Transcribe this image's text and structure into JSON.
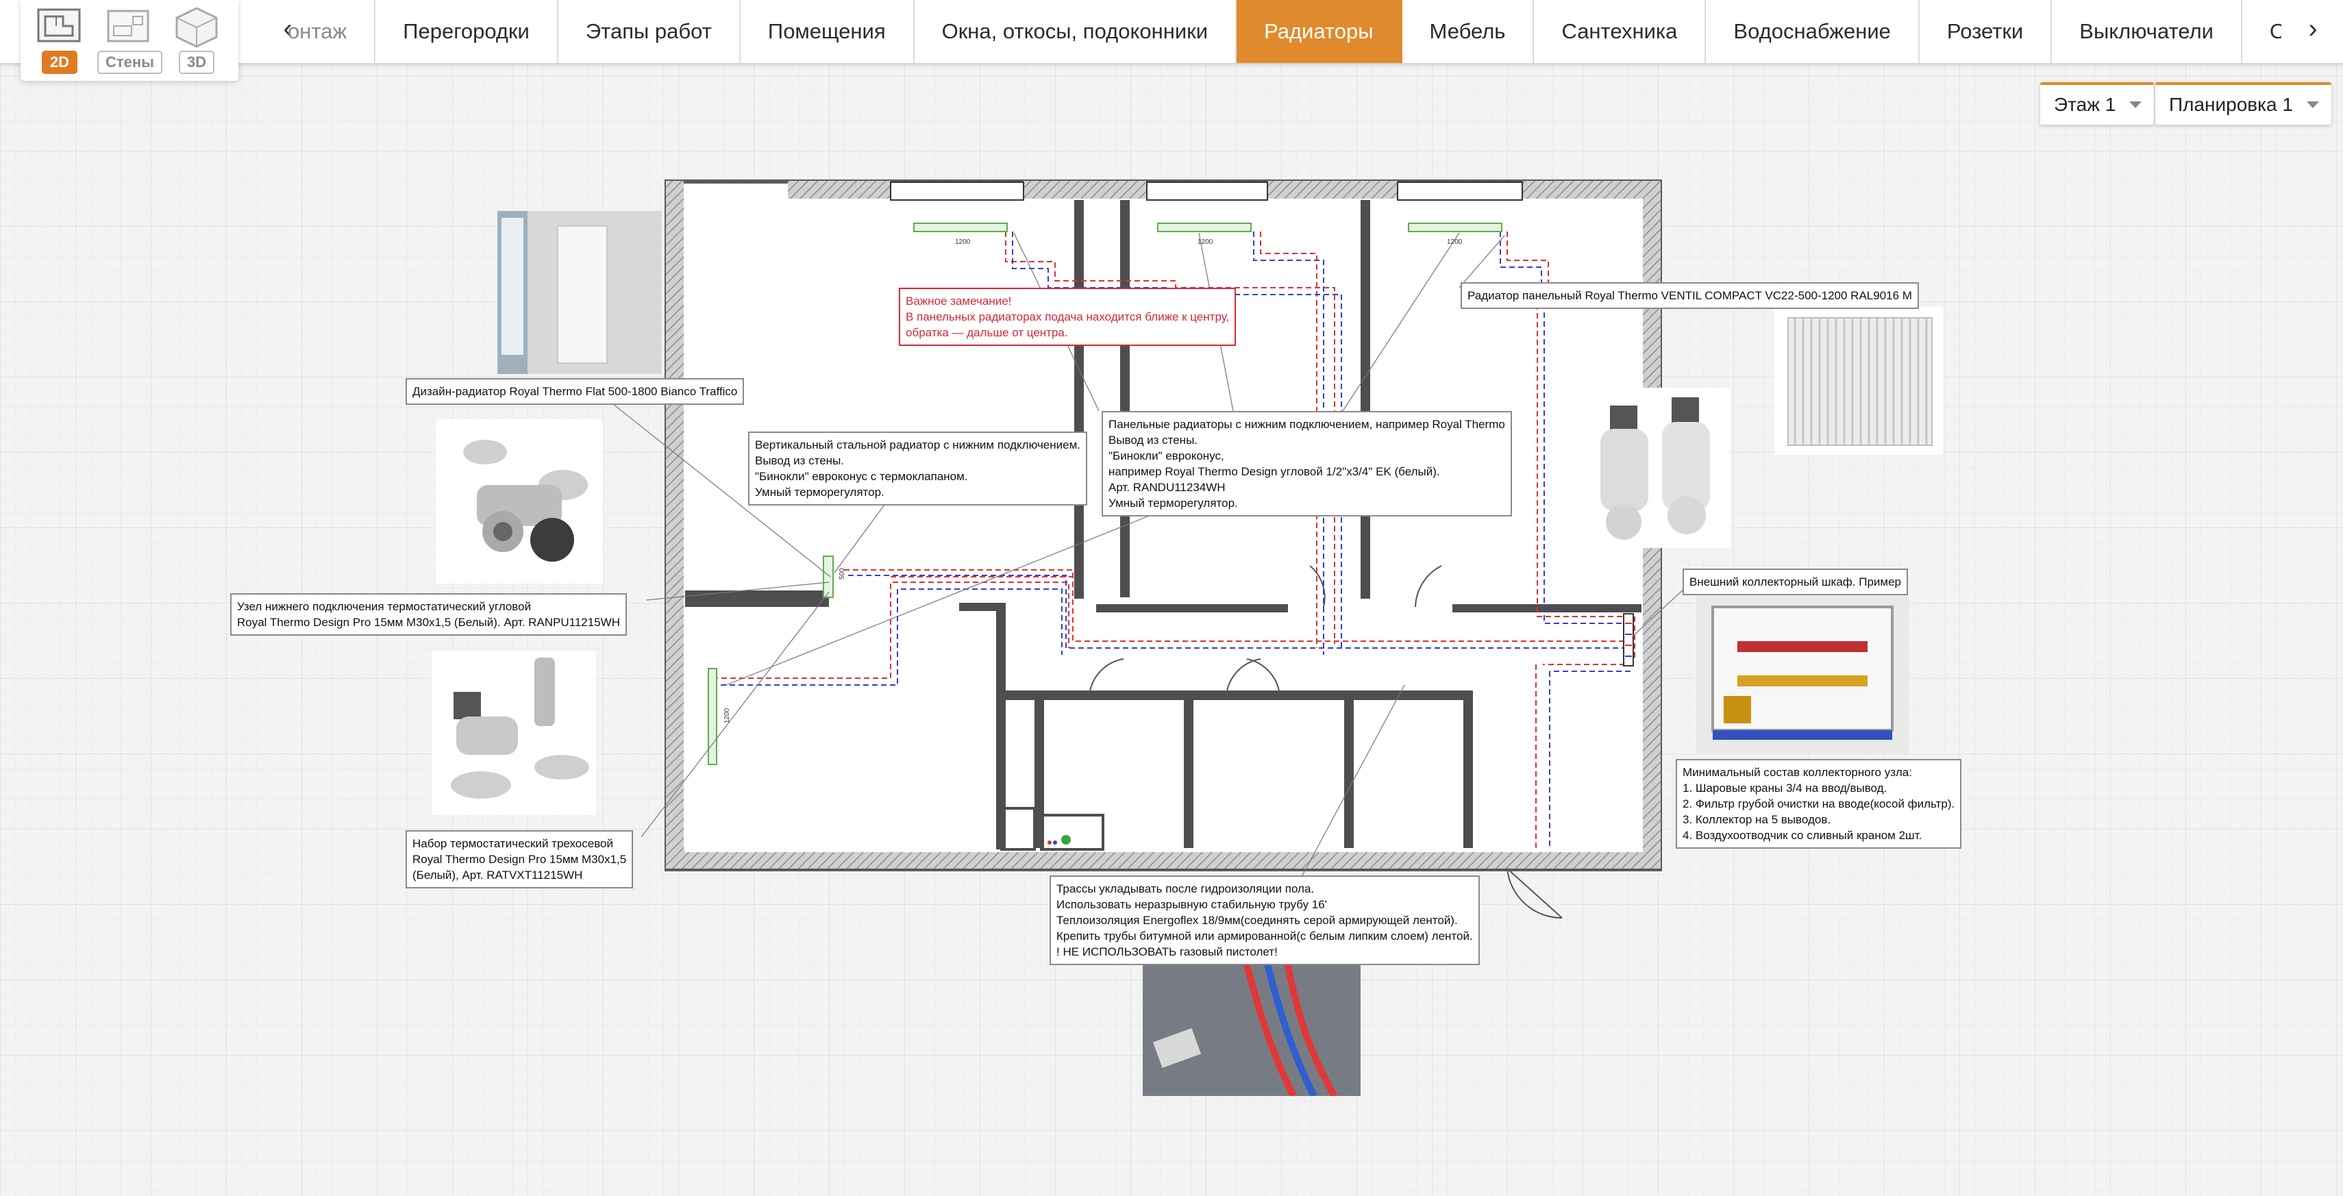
{
  "modes": {
    "view_2d": "2D",
    "walls": "Стены",
    "view_3d": "3D"
  },
  "tabs": [
    {
      "label": "онтаж",
      "active": false
    },
    {
      "label": "Перегородки",
      "active": false
    },
    {
      "label": "Этапы работ",
      "active": false
    },
    {
      "label": "Помещения",
      "active": false
    },
    {
      "label": "Окна, откосы, подоконники",
      "active": false
    },
    {
      "label": "Радиаторы",
      "active": true
    },
    {
      "label": "Мебель",
      "active": false
    },
    {
      "label": "Сантехника",
      "active": false
    },
    {
      "label": "Водоснабжение",
      "active": false
    },
    {
      "label": "Розетки",
      "active": false
    },
    {
      "label": "Выключатели",
      "active": false
    },
    {
      "label": "Освещ",
      "active": false
    }
  ],
  "selectors": {
    "floor": "Этаж 1",
    "layout": "Планировка 1"
  },
  "plan": {
    "dimension_label": "1200",
    "dimension_label_vertical_a": "500",
    "dimension_label_vertical_b": "1200"
  },
  "notes": {
    "important": "Важное замечание!\nВ панельных радиаторах подача находится ближе к центру,\nобратка — дальше от центра.",
    "design_radiator": "Дизайн-радиатор Royal Thermo Flat 500-1800 Bianco Traffico",
    "vertical_radiator": "Вертикальный стальной радиатор с нижним подключением.\nВывод из стены.\n\"Бинокли\" евроконус с термоклапаном.\nУмный терморегулятор.",
    "panel_radiators": "Панельные радиаторы с нижним подключением, например Royal Thermo\nВывод из стены.\n\"Бинокли\" евроконус,\nнапример Royal Thermo Design угловой 1/2\"x3/4\" EK (белый).\nАрт. RANDU11234WH\nУмный терморегулятор.",
    "panel_radiator_model": "Радиатор панельный Royal Thermo VENTIL COMPACT VC22-500-1200 RAL9016 M",
    "bottom_node": "Узел нижнего подключения термостатический угловой\nRoyal Thermo Design Pro 15мм M30x1,5 (Белый). Арт. RANPU11215WH",
    "triaxial_set": "Набор термостатический трехосевой\nRoyal Thermo Design Pro 15мм M30x1,5\n(Белый), Арт. RATVXT11215WH",
    "collector_cabinet": "Внешний коллекторный шкаф. Пример",
    "collector_minimum": "Минимальный состав коллекторного узла:\n1. Шаровые краны 3/4 на ввод/вывод.\n2. Фильтр грубой очистки на вводе(косой фильтр).\n3. Коллектор на 5 выводов.\n4. Воздухоотводчик со сливный краном 2шт.",
    "pipes": "Трассы укладывать после гидроизоляции пола.\nИспользовать неразрывную стабильную трубу 16'\nТеплоизоляция Energoflex 18/9мм(соединять серой армирующей лентой).\nКрепить трубы битумной или армированной(с белым липким слоем) лентой.\n! НЕ ИСПОЛЬЗОВАТЬ газовый пистолет!"
  },
  "colors": {
    "accent": "#e08a2e",
    "supply_pipe": "#e03030",
    "return_pipe": "#3a3ad8",
    "radiator": "#5fae48",
    "wall_hatch": "#9a9a9a"
  }
}
